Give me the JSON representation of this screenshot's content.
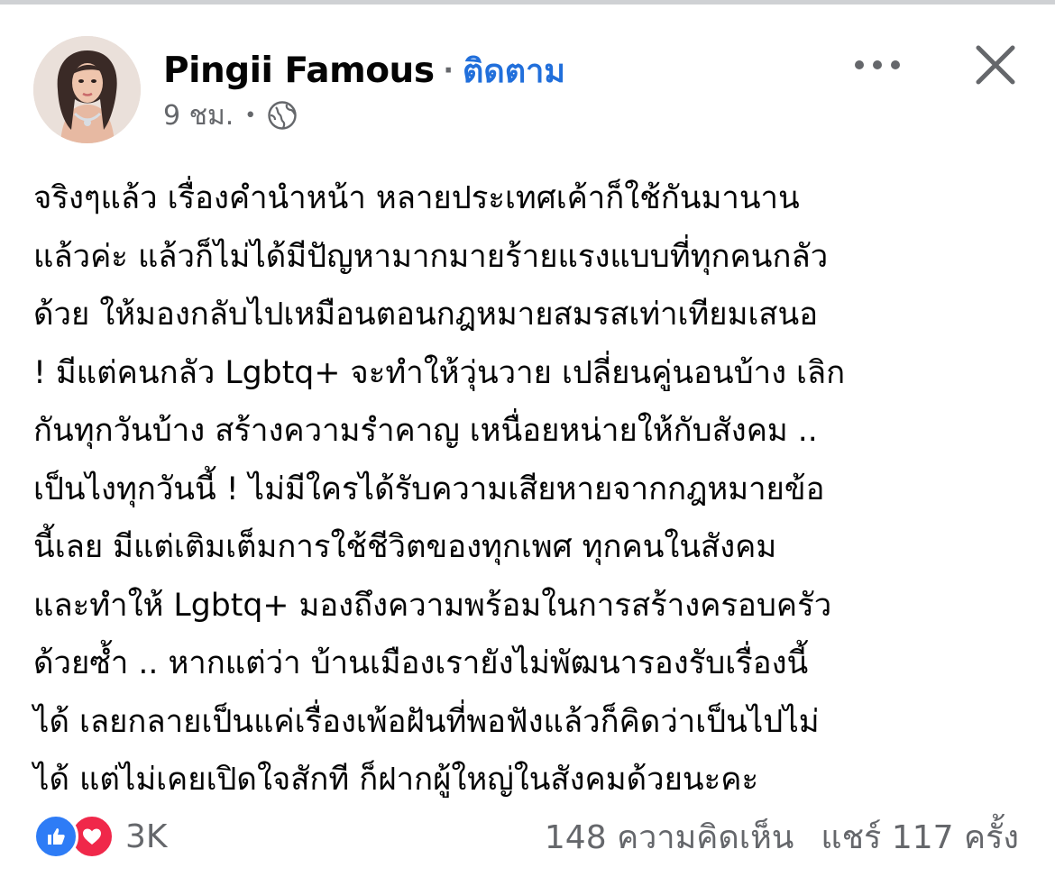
{
  "post": {
    "author": "Pingii Famous",
    "separator": "·",
    "follow_label": "ติดตาม",
    "time": "9 ชม.",
    "meta_separator": "•",
    "audience_icon": "globe-icon",
    "more_icon": "more-horizontal-icon",
    "close_icon": "close-icon",
    "lines": [
      "จริงๆแล้ว เรื่องคำนำหน้า หลายประเทศเค้าก็ใช้กันมานาน",
      "แล้วค่ะ แล้วก็ไม่ได้มีปัญหามากมายร้ายแรงแบบที่ทุกคนกลัว",
      "ด้วย ให้มองกลับไปเหมือนตอนกฎหมายสมรสเท่าเทียมเสนอ",
      "! มีแต่คนกลัว Lgbtq+ จะทำให้วุ่นวาย เปลี่ยนคู่นอนบ้าง เลิก",
      "กันทุกวันบ้าง สร้างความรำคาญ เหนื่อยหน่ายให้กับสังคม ..",
      "เป็นไงทุกวันนี้ ! ไม่มีใครได้รับความเสียหายจากกฎหมายข้อ",
      "นี้เลย มีแต่เติมเต็มการใช้ชีวิตของทุกเพศ ทุกคนในสังคม",
      "และทำให้ Lgbtq+ มองถึงความพร้อมในการสร้างครอบครัว",
      "ด้วยซ้ำ .. หากแต่ว่า บ้านเมืองเรายังไม่พัฒนารองรับเรื่องนี้",
      "ได้ เลยกลายเป็นแค่เรื่องเพ้อฝันที่พอฟังแล้วก็คิดว่าเป็นไปไม่",
      "ได้ แต่ไม่เคยเปิดใจสักที ก็ฝากผู้ใหญ่ในสังคมด้วยนะคะ"
    ]
  },
  "footer": {
    "reaction_icons": [
      "like-icon",
      "love-icon"
    ],
    "reaction_count": "3K",
    "comments": "148 ความคิดเห็น",
    "shares": "แชร์ 117 ครั้ง"
  },
  "colors": {
    "follow": "#216fdb",
    "secondary_text": "#65676b",
    "like": "#2e7cf6",
    "love": "#f0284a"
  }
}
